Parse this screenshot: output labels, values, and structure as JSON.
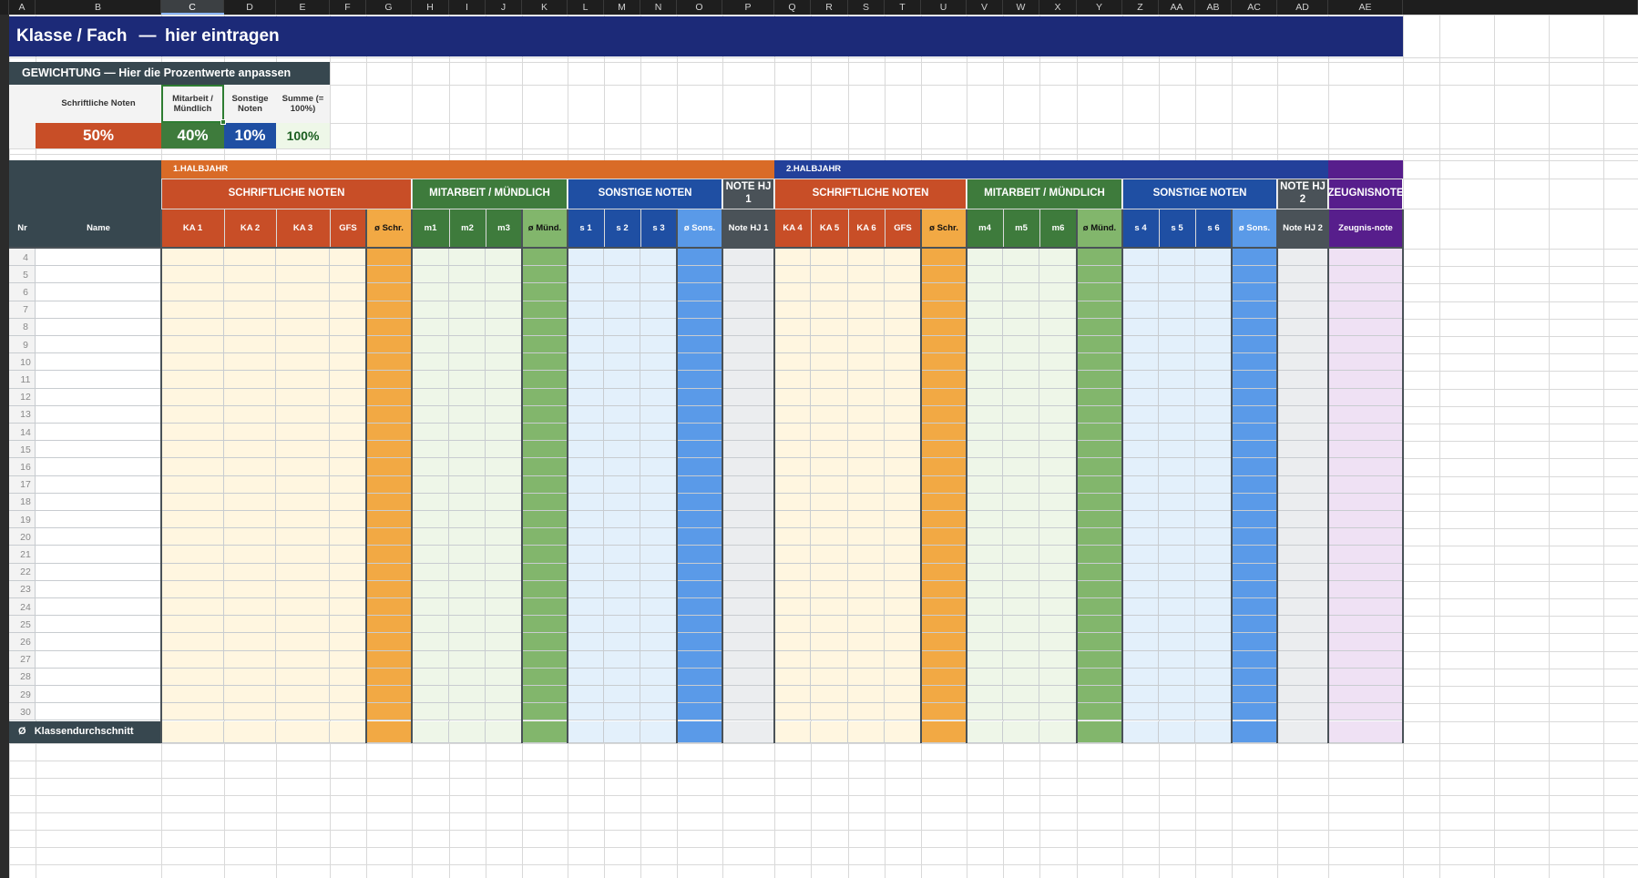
{
  "column_letters": [
    "A",
    "B",
    "C",
    "D",
    "E",
    "F",
    "G",
    "H",
    "I",
    "J",
    "K",
    "L",
    "M",
    "N",
    "O",
    "P",
    "Q",
    "R",
    "S",
    "T",
    "U",
    "V",
    "W",
    "X",
    "Y",
    "Z",
    "AA",
    "AB",
    "AC",
    "AD",
    "AE"
  ],
  "selected_column": "C",
  "title": {
    "part1": "Klasse / Fach",
    "dash": "—",
    "part2": "hier eintragen"
  },
  "weighting": {
    "header": "GEWICHTUNG  —  Hier die Prozentwerte anpassen",
    "labels": [
      "Schriftliche Noten",
      "Mitarbeit / Mündlich",
      "Sonstige Noten",
      "Summe (= 100%)"
    ],
    "values": [
      "50%",
      "40%",
      "10%",
      "100%"
    ]
  },
  "halves": [
    "1.HALBJAHR",
    "2.HALBJAHR"
  ],
  "groups": {
    "h1": [
      "SCHRIFTLICHE NOTEN",
      "MITARBEIT / MÜNDLICH",
      "SONSTIGE NOTEN",
      "NOTE HJ 1"
    ],
    "h2": [
      "SCHRIFTLICHE NOTEN",
      "MITARBEIT / MÜNDLICH",
      "SONSTIGE NOTEN",
      "NOTE HJ 2",
      "ZEUGNISNOTE"
    ]
  },
  "subheaders": [
    "Nr",
    "Name",
    "KA 1",
    "KA 2",
    "KA 3",
    "GFS",
    "ø Schr.",
    "m1",
    "m2",
    "m3",
    "ø Münd.",
    "s 1",
    "s 2",
    "s 3",
    "ø Sons.",
    "Note HJ 1",
    "KA 4",
    "KA 5",
    "KA 6",
    "GFS",
    "ø Schr.",
    "m4",
    "m5",
    "m6",
    "ø Münd.",
    "s 4",
    "s 5",
    "s 6",
    "ø Sons.",
    "Note HJ 2",
    "Zeugnis-note"
  ],
  "row_numbers": [
    "4",
    "5",
    "6",
    "7",
    "8",
    "9",
    "10",
    "11",
    "12",
    "13",
    "14",
    "15",
    "16",
    "17",
    "18",
    "19",
    "20",
    "21",
    "22",
    "23",
    "24",
    "25",
    "26",
    "27",
    "28",
    "29",
    "30"
  ],
  "class_average_label": "Ø   Klassendurchschnitt",
  "colors": {
    "title_bg": "#1c2a78",
    "dark_slate": "#37474f",
    "orange_red": "#c84e27",
    "header_orange": "#d96b27",
    "green": "#3e7b3c",
    "blue": "#1f4fa3",
    "navy": "#23409a",
    "gray": "#4a5258",
    "purple": "#571e8c",
    "avg_orange": "#f2a944",
    "avg_green": "#82b66c",
    "avg_blue": "#5a9ae8"
  }
}
